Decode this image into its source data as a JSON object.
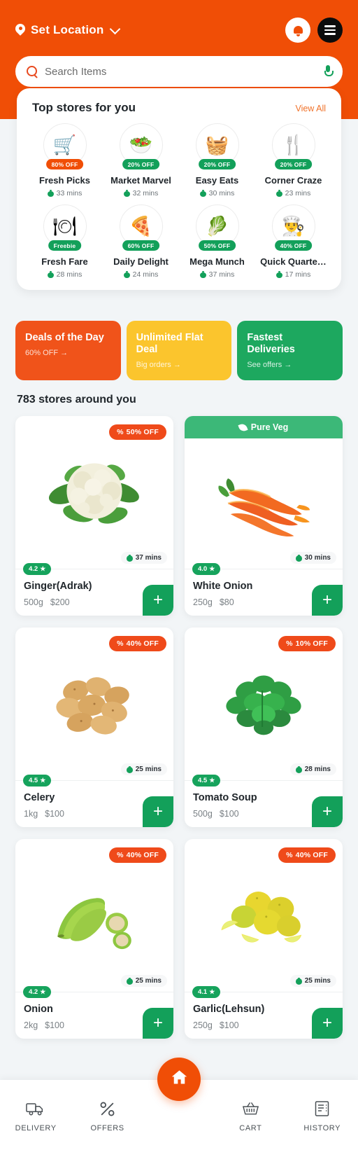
{
  "header": {
    "location_label": "Set Location",
    "location_icon": "map-pin-icon",
    "chevron_icon": "chevron-down-icon",
    "bell_icon": "notification-bell-icon",
    "menu_icon": "hamburger-menu-icon",
    "accent_color": "#f04e06"
  },
  "search": {
    "placeholder": "Search Items",
    "search_icon": "search-icon",
    "mic_icon": "microphone-icon"
  },
  "top_stores": {
    "title": "Top stores for you",
    "view_all": "View All",
    "items": [
      {
        "name": "Fresh Picks",
        "badge": "80% OFF",
        "badge_color": "#f04e06",
        "time": "33 mins",
        "glyph": "🛒"
      },
      {
        "name": "Market Marvel",
        "badge": "20% OFF",
        "badge_color": "#13a05a",
        "time": "32 mins",
        "glyph": "🥗"
      },
      {
        "name": "Easy Eats",
        "badge": "20% OFF",
        "badge_color": "#13a05a",
        "time": "30 mins",
        "glyph": "🧺"
      },
      {
        "name": "Corner Craze",
        "badge": "20% OFF",
        "badge_color": "#13a05a",
        "time": "23 mins",
        "glyph": "🍴"
      },
      {
        "name": "Fresh Fare",
        "badge": "Freebie",
        "badge_color": "#13a05a",
        "time": "28 mins",
        "glyph": "🍽"
      },
      {
        "name": "Daily Delight",
        "badge": "60% OFF",
        "badge_color": "#13a05a",
        "time": "24 mins",
        "glyph": "🍕"
      },
      {
        "name": "Mega Munch",
        "badge": "50% OFF",
        "badge_color": "#13a05a",
        "time": "37 mins",
        "glyph": "🥬"
      },
      {
        "name": "Quick Quarte…",
        "badge": "40% OFF",
        "badge_color": "#13a05a",
        "time": "17 mins",
        "glyph": "👨‍🍳"
      }
    ]
  },
  "promos": [
    {
      "title": "Deals of the Day",
      "sub": "60% OFF →",
      "color": "#f0531a"
    },
    {
      "title": "Unlimited Flat Deal",
      "sub": "Big orders →",
      "color": "#fbc52d"
    },
    {
      "title": "Fastest Deliveries",
      "sub": "See offers →",
      "color": "#1da85f"
    }
  ],
  "stores_count_title": "783 stores around you",
  "products": [
    {
      "name": "Ginger(Adrak)",
      "weight": "500g",
      "price": "$200",
      "rating": "4.2",
      "time": "37 mins",
      "badge": "50% OFF",
      "banner": null,
      "image": "cauliflower"
    },
    {
      "name": "White Onion",
      "weight": "250g",
      "price": "$80",
      "rating": "4.0",
      "time": "30 mins",
      "badge": null,
      "banner": "Pure Veg",
      "image": "carrots"
    },
    {
      "name": "Celery",
      "weight": "1kg",
      "price": "$100",
      "rating": "4.5",
      "time": "25 mins",
      "badge": "40% OFF",
      "banner": null,
      "image": "potatoes"
    },
    {
      "name": "Tomato Soup",
      "weight": "500g",
      "price": "$100",
      "rating": "4.5",
      "time": "28 mins",
      "badge": "10% OFF",
      "banner": null,
      "image": "mint"
    },
    {
      "name": "Onion",
      "weight": "2kg",
      "price": "$100",
      "rating": "4.2",
      "time": "25 mins",
      "badge": "40% OFF",
      "banner": null,
      "image": "plantain"
    },
    {
      "name": "Garlic(Lehsun)",
      "weight": "250g",
      "price": "$100",
      "rating": "4.1",
      "time": "25 mins",
      "badge": "40% OFF",
      "banner": null,
      "image": "lemons"
    }
  ],
  "add_button_label": "+",
  "bottom_nav": {
    "items": [
      {
        "label": "DELIVERY",
        "icon": "truck-icon"
      },
      {
        "label": "OFFERS",
        "icon": "percent-icon"
      },
      {
        "label": "CART",
        "icon": "basket-icon"
      },
      {
        "label": "HISTORY",
        "icon": "receipt-icon"
      }
    ],
    "home_icon": "home-icon"
  }
}
